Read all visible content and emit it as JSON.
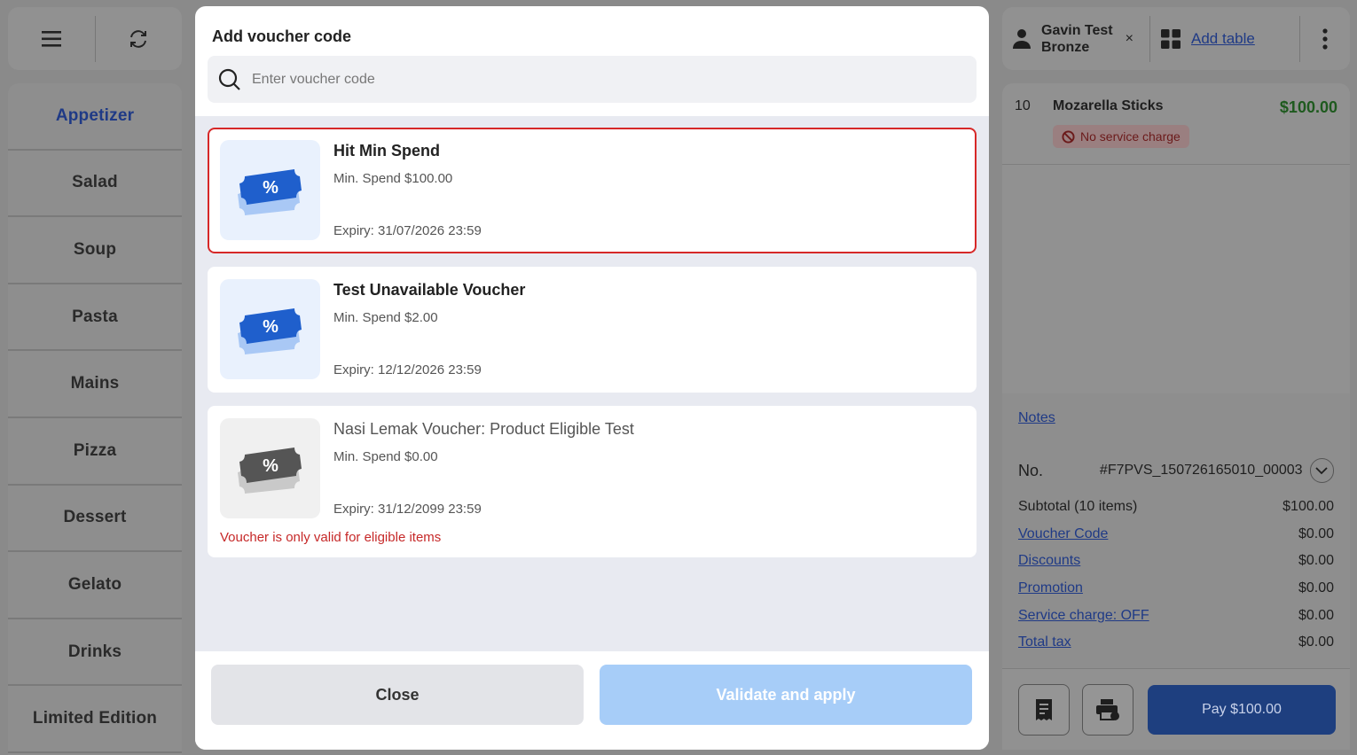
{
  "sidebar": {
    "menu_icon": "hamburger-icon",
    "refresh_icon": "refresh-icon",
    "categories": [
      {
        "label": "Appetizer",
        "active": true
      },
      {
        "label": "Salad"
      },
      {
        "label": "Soup"
      },
      {
        "label": "Pasta"
      },
      {
        "label": "Mains"
      },
      {
        "label": "Pizza"
      },
      {
        "label": "Dessert"
      },
      {
        "label": "Gelato"
      },
      {
        "label": "Drinks"
      },
      {
        "label": "Limited Edition"
      }
    ]
  },
  "header_right": {
    "customer_name": "Gavin Test",
    "customer_tier": "Bronze",
    "remove_label": "×",
    "add_table_label": "Add table"
  },
  "order": {
    "items": [
      {
        "qty": "10",
        "name": "Mozarella Sticks",
        "price": "$100.00",
        "tag": "No service charge"
      }
    ]
  },
  "summary": {
    "notes_label": "Notes",
    "order_no_label": "No.",
    "order_no": "#F7PVS_150726165010_00003",
    "rows": [
      {
        "label": "Subtotal (10 items)",
        "value": "$100.00"
      },
      {
        "label": "Voucher Code",
        "value": "$0.00"
      },
      {
        "label": "Discounts",
        "value": "$0.00"
      },
      {
        "label": "Promotion",
        "value": "$0.00"
      },
      {
        "label": "Service charge: OFF",
        "value": "$0.00"
      },
      {
        "label": "Total tax",
        "value": "$0.00"
      }
    ],
    "pay_label": "Pay $100.00"
  },
  "modal": {
    "title": "Add voucher code",
    "search_placeholder": "Enter voucher code",
    "vouchers": [
      {
        "title": "Hit Min Spend",
        "min_spend": "Min. Spend $100.00",
        "expiry": "Expiry: 31/07/2026 23:59",
        "selected": true
      },
      {
        "title": "Test Unavailable Voucher",
        "min_spend": "Min. Spend $2.00",
        "expiry": "Expiry: 12/12/2026 23:59"
      },
      {
        "title": "Nasi Lemak Voucher: Product Eligible Test",
        "min_spend": "Min. Spend $0.00",
        "expiry": "Expiry: 31/12/2099 23:59",
        "error": "Voucher is only valid for eligible items",
        "disabled": true
      }
    ],
    "close_label": "Close",
    "apply_label": "Validate and apply"
  },
  "colors": {
    "accent_blue": "#1a56db",
    "selected_outline": "#d62828",
    "error_text": "#c62828",
    "apply_disabled": "#a7cdf8"
  }
}
